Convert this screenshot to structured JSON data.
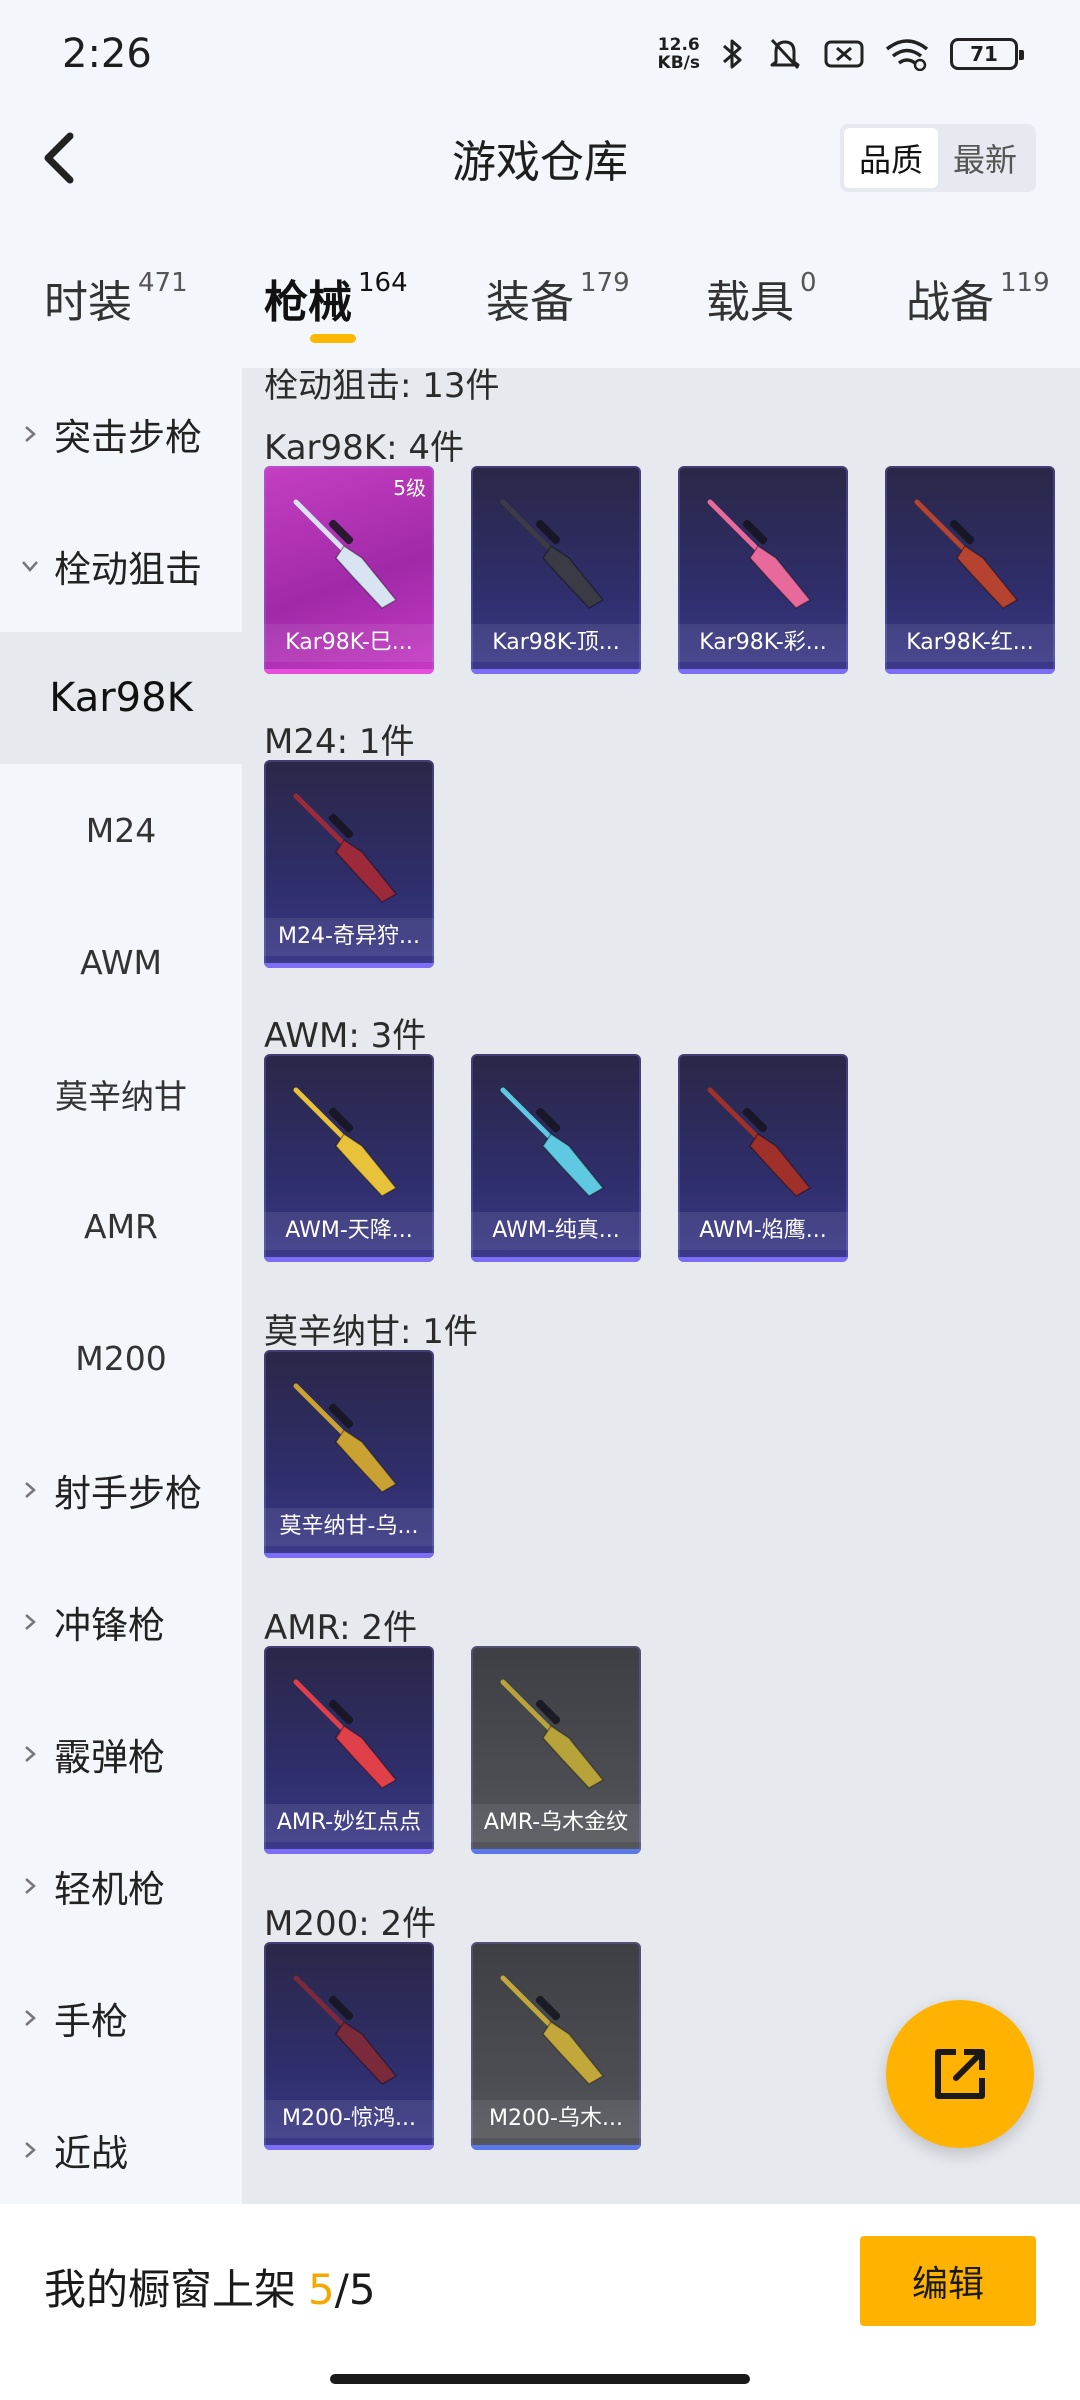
{
  "status_bar": {
    "time": "2:26",
    "net_speed_value": "12.6",
    "net_speed_unit": "KB/s",
    "battery": "71"
  },
  "header": {
    "title": "游戏仓库",
    "sort_options": [
      "品质",
      "最新"
    ],
    "active_sort": "品质"
  },
  "tabs": [
    {
      "label": "时装",
      "count": "471"
    },
    {
      "label": "枪械",
      "count": "164"
    },
    {
      "label": "装备",
      "count": "179"
    },
    {
      "label": "载具",
      "count": "0"
    },
    {
      "label": "战备",
      "count": "119"
    }
  ],
  "active_tab": "枪械",
  "sidebar": {
    "items": [
      {
        "label": "突击步枪",
        "kind": "group",
        "expanded": false
      },
      {
        "label": "栓动狙击",
        "kind": "group",
        "expanded": true
      },
      {
        "label": "Kar98K",
        "kind": "sub",
        "selected": true
      },
      {
        "label": "M24",
        "kind": "sub"
      },
      {
        "label": "AWM",
        "kind": "sub"
      },
      {
        "label": "莫辛纳甘",
        "kind": "sub"
      },
      {
        "label": "AMR",
        "kind": "sub"
      },
      {
        "label": "M200",
        "kind": "sub"
      },
      {
        "label": "射手步枪",
        "kind": "group",
        "expanded": false
      },
      {
        "label": "冲锋枪",
        "kind": "group",
        "expanded": false
      },
      {
        "label": "霰弹枪",
        "kind": "group",
        "expanded": false
      },
      {
        "label": "轻机枪",
        "kind": "group",
        "expanded": false
      },
      {
        "label": "手枪",
        "kind": "group",
        "expanded": false
      },
      {
        "label": "近战",
        "kind": "group",
        "expanded": false
      }
    ]
  },
  "main": {
    "category_header": "栓动狙击: 13件",
    "sections": [
      {
        "title": "Kar98K: 4件",
        "items": [
          {
            "name": "Kar98K-巳...",
            "quality": "purple",
            "badge": "5级",
            "gun_color": "#d9e4f2"
          },
          {
            "name": "Kar98K-顶...",
            "quality": "blue",
            "gun_color": "#3b3b45"
          },
          {
            "name": "Kar98K-彩...",
            "quality": "blue",
            "gun_color": "#e86a9a"
          },
          {
            "name": "Kar98K-红...",
            "quality": "blue",
            "gun_color": "#b5432f"
          }
        ]
      },
      {
        "title": "M24: 1件",
        "items": [
          {
            "name": "M24-奇异狩...",
            "quality": "blue",
            "gun_color": "#9c2a3a"
          }
        ]
      },
      {
        "title": "AWM: 3件",
        "items": [
          {
            "name": "AWM-天降...",
            "quality": "blue",
            "gun_color": "#e8c23a"
          },
          {
            "name": "AWM-纯真...",
            "quality": "blue",
            "gun_color": "#5ec9e0"
          },
          {
            "name": "AWM-焰鹰...",
            "quality": "blue",
            "gun_color": "#a0302a"
          }
        ]
      },
      {
        "title": "莫辛纳甘: 1件",
        "items": [
          {
            "name": "莫辛纳甘-乌...",
            "quality": "blue",
            "gun_color": "#c9a233"
          }
        ]
      },
      {
        "title": "AMR: 2件",
        "items": [
          {
            "name": "AMR-妙红点点",
            "quality": "blue",
            "gun_color": "#e0404a"
          },
          {
            "name": "AMR-乌木金纹",
            "quality": "grey",
            "gun_color": "#b8a23a"
          }
        ]
      },
      {
        "title": "M200: 2件",
        "items": [
          {
            "name": "M200-惊鸿...",
            "quality": "blue",
            "gun_color": "#7a2a3a"
          },
          {
            "name": "M200-乌木...",
            "quality": "grey",
            "gun_color": "#c2a83a"
          }
        ]
      }
    ]
  },
  "bottom_bar": {
    "showcase_label": "我的橱窗上架",
    "showcase_count": "5",
    "showcase_total": "/5",
    "edit_label": "编辑"
  },
  "colors": {
    "accent": "#ffb300",
    "count_highlight": "#f5a800"
  }
}
